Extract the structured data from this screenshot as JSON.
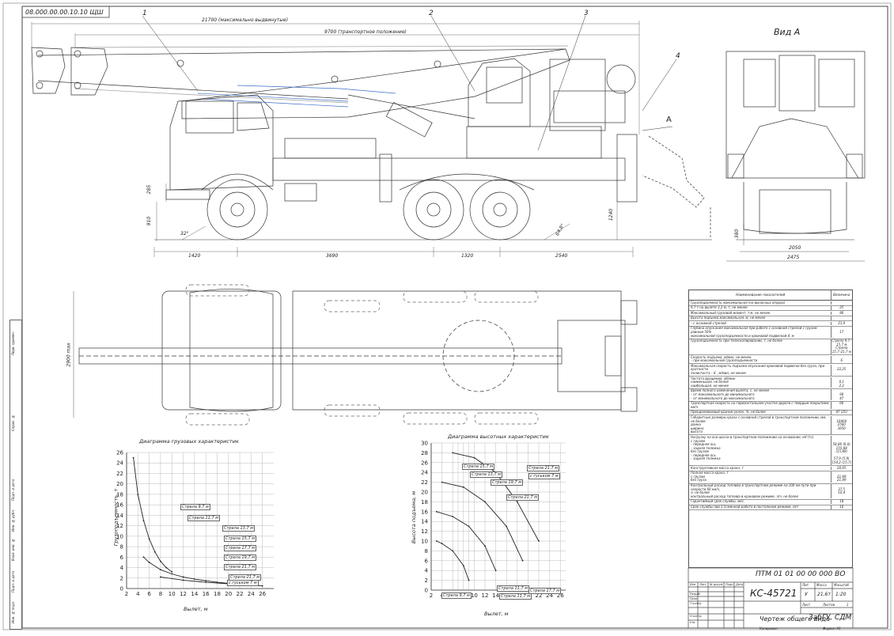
{
  "doc_code_top": "08.000.00.00.10.10 ЩШ",
  "dims": {
    "max_extended": "21700 (максимально выдвинутые)",
    "transport": "9700 (транспортное положение)",
    "h285": "285",
    "h910": "910",
    "h1240": "1240",
    "angle_left": "32°",
    "angle_right": "64,8°",
    "d1420": "1420",
    "d3690": "3690",
    "d1320": "1320",
    "d2540": "2540",
    "v380": "380",
    "v2050": "2050",
    "v2475": "2475",
    "w2900": "2900 max"
  },
  "callouts": [
    "1",
    "2",
    "3",
    "4"
  ],
  "view_a_title": "Вид А",
  "view_a_marker": "А",
  "side_stamps": [
    "Перв. примен.",
    "Справ. №",
    "Подп. и дата",
    "Инв. № дубл.",
    "Взам. инв. №",
    "Подп. и дата",
    "Инв. № подл."
  ],
  "specs": {
    "header_name": "Наименование показателей",
    "header_value": "Величина",
    "rows": [
      {
        "name": "Грузоподъемность максимальная (на выносных опорах)",
        "value": ""
      },
      {
        "name": "9,7 т на вылете 3,2 м, т, не менее",
        "value": "25"
      },
      {
        "name": "Максимальный грузовой момент, т·м, не менее",
        "value": "80"
      },
      {
        "name": "Высота подъема максимальная, м, не менее",
        "value": ""
      },
      {
        "name": "– с основной стрелой",
        "value": "21,9"
      },
      {
        "name": "Глубина опускания максимальная при работе с основной стрелой с грузом равным 50%\nмаксимальной грузоподъемности и крюковой подвеской 4, м",
        "value": "\n17"
      },
      {
        "name": "Грузоподъемность при телескопировании, т, не более",
        "value": "Стрела 9,7–15,7 м\nСтрела 15,7–21,7 м"
      },
      {
        "name": "Скорость подъема, м/мин, не менее\n– при максимальной грузоподъемности",
        "value": "\n6"
      },
      {
        "name": "Максимальная скорость подъема-опускания крюковой подвески без груза, при кратности\nполиспаста – 8 , м/мин, не менее",
        "value": "\n22,25"
      },
      {
        "name": "Частота вращения, об/мин\nнаименьшая, не более\nнаибольшая, не менее",
        "value": "\n0,1\n2,2"
      },
      {
        "name": "Время полного изменения вылета, с, не менее\n– от максимального до минимального\n– от минимального до максимального",
        "value": "\n90\n47"
      },
      {
        "name": "Транспортная скорость на горизонтальном участке дороги с твердым покрытием, км/ч",
        "value": "60"
      },
      {
        "name": "Преодолеваемый краном уклон, %, не более",
        "value": "47 (25)"
      },
      {
        "name": "Габаритные размеры крана с основной стрелой в транспортном положении, мм, не более\nдлина\nширина\nвысота",
        "value": "\n10900\n2500\n3650"
      },
      {
        "name": "Нагрузку на оси шасси в транспортном положении на основание, кН (тс)\nс грузом\n– передняя ось\n– задняя тележка\nбез грузом\n– передняя ось\n– задняя тележка",
        "value": "\n\n58,86 (6,0)\n155,88 (15,89)\n\n57,9 (5,9)\n154,2 (15,7)"
      },
      {
        "name": "Конструктивная масса крана, т",
        "value": "20,65"
      },
      {
        "name": "Полная масса крана, т\nс грузом\nбез груза",
        "value": "\n21,89\n21,49"
      },
      {
        "name": "Контрольный расход топлива в транспортном режиме на 100 км пути при скорости 60 км/ч,\nл, не более\nконтрольный расход топлива в крановом режиме, л/ч, не более",
        "value": "\n37,5\n10,4"
      },
      {
        "name": "Гарантийный срок службы, мес.",
        "value": "18"
      },
      {
        "name": "Срок службы при 1,5сменной работе в постоянном режиме, лет",
        "value": "10"
      }
    ]
  },
  "load_chart": {
    "title": "Диаграмма грузовых характеристик",
    "ylabel": "Грузоподъемность, т",
    "xlabel": "Вылет, м",
    "labels": [
      "Стрела 9,7 м",
      "Стрела 11,7 м",
      "Стрела 13,7 м",
      "Стрела 15,7 м",
      "Стрела 17,7 м",
      "Стрела 19,7 м",
      "Стрела 21,7 м",
      "Стрела 21,7 м",
      "с гуськом 7 м"
    ]
  },
  "height_chart": {
    "title": "Диаграмма высотных характеристик",
    "ylabel": "Высота подъема, м",
    "xlabel": "Вылет, м",
    "labels": [
      "Стрела 15,7 м",
      "Стрела 13,7 м",
      "Стрела 19,7 м",
      "Стрела 21,7 м",
      "Стрела 21,7 м",
      "с гуськом 7 м",
      "Стрела 17,7 м",
      "Стрела 11,7 м",
      "Стрела 9,7 м",
      "Стрела 11,7 м"
    ]
  },
  "chart_data": [
    {
      "type": "line",
      "title": "Диаграмма грузовых характеристик",
      "xlabel": "Вылет, м",
      "ylabel": "Грузоподъемность, т",
      "xlim": [
        2,
        28
      ],
      "ylim": [
        0,
        26
      ],
      "xticks": [
        2,
        4,
        6,
        8,
        10,
        12,
        14,
        16,
        18,
        20,
        22,
        24,
        26
      ],
      "yticks": [
        0,
        2,
        4,
        6,
        8,
        10,
        12,
        14,
        16,
        18,
        20,
        22,
        24,
        26
      ],
      "series": [
        {
          "name": "Стрела 9,7 м",
          "x": [
            3.2,
            4,
            5,
            6,
            7,
            8,
            9,
            10
          ],
          "y": [
            25,
            18,
            13,
            9.5,
            7,
            5.2,
            4,
            3.2
          ]
        },
        {
          "name": "Стрела 21,7 м",
          "x": [
            5,
            6,
            8,
            10,
            12,
            14,
            16,
            18,
            20
          ],
          "y": [
            6,
            5,
            3.6,
            2.8,
            2.2,
            1.8,
            1.5,
            1.2,
            1.0
          ]
        },
        {
          "name": "с гуськом 7 м",
          "x": [
            8,
            12,
            16,
            20,
            24,
            26
          ],
          "y": [
            2.2,
            1.6,
            1.2,
            0.9,
            0.6,
            0.5
          ]
        }
      ]
    },
    {
      "type": "line",
      "title": "Диаграмма высотных характеристик",
      "xlabel": "Вылет, м",
      "ylabel": "Высота подъема, м",
      "xlim": [
        2,
        27
      ],
      "ylim": [
        0,
        30
      ],
      "xticks": [
        2,
        4,
        6,
        7,
        8,
        9,
        10,
        12,
        14,
        16,
        18,
        20,
        22,
        24,
        26
      ],
      "yticks": [
        0,
        2,
        4,
        6,
        8,
        10,
        12,
        14,
        16,
        18,
        20,
        22,
        24,
        26,
        28,
        30
      ],
      "series": [
        {
          "name": "Стрела 9,7 м",
          "x": [
            3,
            4,
            6,
            8,
            9
          ],
          "y": [
            10,
            9.5,
            8,
            5,
            2
          ]
        },
        {
          "name": "Стрела 15,7 м",
          "x": [
            3,
            6,
            9,
            12,
            14
          ],
          "y": [
            16,
            15,
            13,
            9,
            4
          ]
        },
        {
          "name": "Стрела 21,7 м",
          "x": [
            4,
            8,
            12,
            16,
            19
          ],
          "y": [
            22,
            21,
            18,
            13,
            6
          ]
        },
        {
          "name": "с гуськом 7 м",
          "x": [
            6,
            10,
            14,
            18,
            22
          ],
          "y": [
            28,
            27,
            24,
            18,
            10
          ]
        }
      ]
    }
  ],
  "title_block": {
    "doc_code": "ПТМ 01 01 00 00 000 ВО",
    "product": "КС-45721",
    "doc_title": "Чертеж общего вида",
    "org": "ЗабГУ, СДМ",
    "lit_hdr": "Лит.",
    "mass_hdr": "Масса",
    "scale_hdr": "Масштаб",
    "lit": "У",
    "mass": "21,6т",
    "scale": "1:20",
    "sheet_hdr": "Лист",
    "sheets_hdr": "Листов",
    "sheets": "1",
    "row_labels": [
      "Изм",
      "Лист",
      "№ докум.",
      "Подп.",
      "Дата"
    ],
    "roles": [
      "Разраб.",
      "Пров.",
      "Т.контр.",
      "Н.контр.",
      "Утв."
    ],
    "copied": "Копировал",
    "format": "Формат    А1"
  }
}
